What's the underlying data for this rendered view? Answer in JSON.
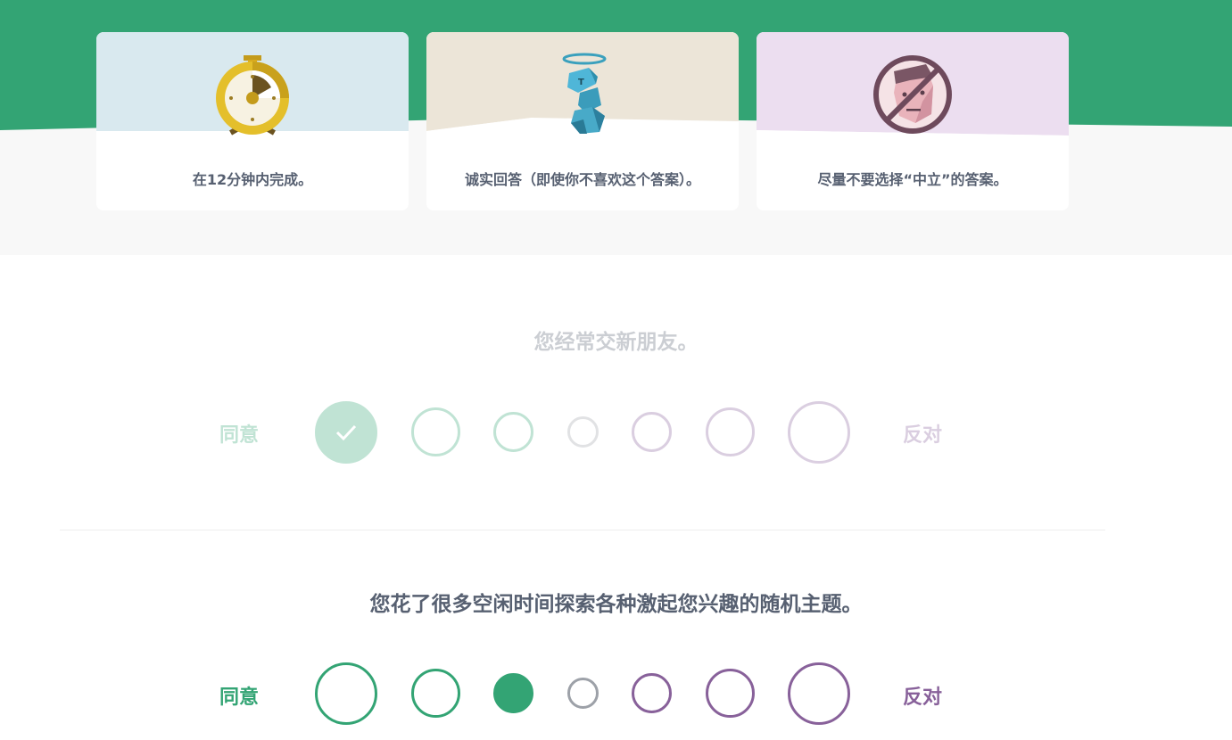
{
  "colors": {
    "brand_green": "#33a474",
    "agree_green": "#33a474",
    "neutral_gray": "#9da1a8",
    "disagree_purple": "#88619a",
    "text_dark": "#576071"
  },
  "tips": [
    {
      "icon": "stopwatch-icon",
      "text": "在12分钟内完成。",
      "bg": "#d9e9ef"
    },
    {
      "icon": "honest-character-icon",
      "text": "诚实回答（即使你不喜欢这个答案）。",
      "bg": "#ece5d8"
    },
    {
      "icon": "no-neutral-face-icon",
      "text": "尽量不要选择“中立”的答案。",
      "bg": "#ecdef0"
    }
  ],
  "questions": [
    {
      "text": "您经常交新朋友。",
      "agree_label": "同意",
      "disagree_label": "反对",
      "selected_index": 0,
      "state": "answered-faded"
    },
    {
      "text": "您花了很多空闲时间探索各种激起您兴趣的随机主题。",
      "agree_label": "同意",
      "disagree_label": "反对",
      "selected_index": 2,
      "state": "active"
    }
  ]
}
